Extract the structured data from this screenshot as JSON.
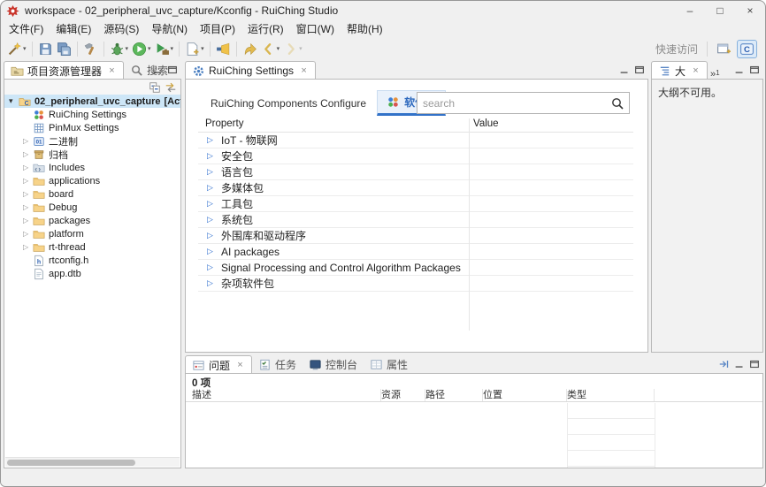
{
  "window": {
    "title": "workspace - 02_peripheral_uvc_capture/Kconfig - RuiChing Studio"
  },
  "menu": {
    "items": [
      "文件(F)",
      "编辑(E)",
      "源码(S)",
      "导航(N)",
      "项目(P)",
      "运行(R)",
      "窗口(W)",
      "帮助(H)"
    ]
  },
  "toolbar": {
    "quick_access": "快速访问",
    "buttons": [
      {
        "icon": "new-wizard",
        "caret": true
      },
      {
        "sep": true
      },
      {
        "icon": "save"
      },
      {
        "icon": "save-all"
      },
      {
        "sep": true
      },
      {
        "icon": "build"
      },
      {
        "sep": true
      },
      {
        "icon": "debug",
        "caret": true
      },
      {
        "icon": "run",
        "caret": true
      },
      {
        "icon": "external-tools",
        "caret": true
      },
      {
        "sep": true
      },
      {
        "icon": "new-file",
        "caret": true
      },
      {
        "sep": true
      },
      {
        "icon": "search"
      },
      {
        "sep": true
      },
      {
        "icon": "last-edit"
      },
      {
        "icon": "back",
        "caret": true
      },
      {
        "icon": "forward",
        "caret": true,
        "disabled": true
      }
    ]
  },
  "explorer": {
    "tab": "项目资源管理器",
    "search_tab": "搜索",
    "tree": [
      {
        "label": "02_peripheral_uvc_capture",
        "suffix": "[Active",
        "icon": "c-project",
        "tw": "open",
        "level": 0,
        "selected": true
      },
      {
        "label": "RuiChing Settings",
        "icon": "components",
        "tw": "none",
        "level": 1
      },
      {
        "label": "PinMux Settings",
        "icon": "pinmux",
        "tw": "none",
        "level": 1
      },
      {
        "label": "二进制",
        "icon": "binary",
        "tw": "closed",
        "level": 1
      },
      {
        "label": "归档",
        "icon": "archive",
        "tw": "closed",
        "level": 1
      },
      {
        "label": "Includes",
        "icon": "includes",
        "tw": "closed",
        "level": 1
      },
      {
        "label": "applications",
        "icon": "folder",
        "tw": "closed",
        "level": 1
      },
      {
        "label": "board",
        "icon": "folder",
        "tw": "closed",
        "level": 1
      },
      {
        "label": "Debug",
        "icon": "folder",
        "tw": "closed",
        "level": 1
      },
      {
        "label": "packages",
        "icon": "folder",
        "tw": "closed",
        "level": 1
      },
      {
        "label": "platform",
        "icon": "folder",
        "tw": "closed",
        "level": 1
      },
      {
        "label": "rt-thread",
        "icon": "folder",
        "tw": "closed",
        "level": 1
      },
      {
        "label": "rtconfig.h",
        "icon": "file-h",
        "tw": "none",
        "level": 1
      },
      {
        "label": "app.dtb",
        "icon": "file",
        "tw": "none",
        "level": 1
      }
    ]
  },
  "editor": {
    "tab": "RuiChing Settings",
    "subtabs": [
      {
        "label": "RuiChing Components Configure",
        "active": false
      },
      {
        "label": "软件包",
        "active": true,
        "icon": "components"
      }
    ],
    "search_placeholder": "search",
    "table": {
      "property_header": "Property",
      "value_header": "Value",
      "rows": [
        "IoT - 物联网",
        "安全包",
        "语言包",
        "多媒体包",
        "工具包",
        "系统包",
        "外围库和驱动程序",
        "AI packages",
        "Signal Processing and Control Algorithm Packages",
        "杂项软件包"
      ]
    }
  },
  "outline": {
    "tab": "大",
    "chevron": "»",
    "chevron_count": "1",
    "message": "大纲不可用。"
  },
  "problems": {
    "count": "0 项",
    "tabs": [
      {
        "label": "问题",
        "icon": "problems",
        "active": true
      },
      {
        "label": "任务",
        "icon": "tasks"
      },
      {
        "label": "控制台",
        "icon": "console"
      },
      {
        "label": "属性",
        "icon": "properties"
      }
    ],
    "headers": [
      "描述",
      "资源",
      "路径",
      "位置",
      "类型"
    ]
  },
  "colors": {
    "accent_blue": "#3272c8",
    "selection_blue": "#cde6f7",
    "active_subtab_bg": "#e9f1fb"
  }
}
